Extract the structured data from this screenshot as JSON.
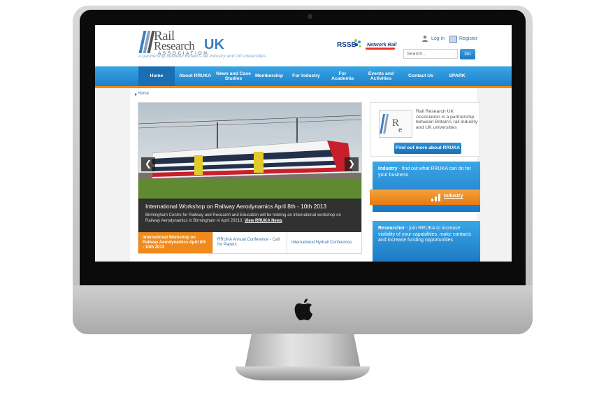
{
  "header": {
    "logo": {
      "rail": "Rail",
      "research": "Research",
      "uk": "UK",
      "association": "ASSOCIATION"
    },
    "tagline": "A partnership between Britain's rail industry and UK universities",
    "partners": {
      "rssb": "RSSB",
      "network_rail": "Network Rail"
    },
    "login_label": "Log in",
    "register_label": "Register",
    "search_placeholder": "Search...",
    "search_button": "Go"
  },
  "nav": {
    "items": [
      {
        "label": "Home",
        "active": true
      },
      {
        "label": "About RRUKA"
      },
      {
        "label": "News and Case Studies"
      },
      {
        "label": "Membership"
      },
      {
        "label": "For Industry"
      },
      {
        "label": "For Academia"
      },
      {
        "label": "Events and Activities"
      },
      {
        "label": "Contact Us"
      },
      {
        "label": "SPARK"
      }
    ]
  },
  "breadcrumb": {
    "home": "Home"
  },
  "slider": {
    "title": "International Workshop on Railway Aerodynamics April 8th - 10th 2013",
    "text": "Birmingham Centre for Railway and Research and Education will be  holding an international workshop on Railway Aerodynamics in Birmingham in April 20213.",
    "link": "View RRUKA News",
    "prev": "❮",
    "next": "❯",
    "tabs": [
      {
        "label": "International Workshop on Railway Aerodynamics April 8th - 10th 2013",
        "active": true
      },
      {
        "label": "RRUKA Annual Conference - Call for Papers"
      },
      {
        "label": "International Hydrail Conference"
      }
    ]
  },
  "sidebar": {
    "about_text": "Rail Research UK Association is a partnership between Britain's rail industry and UK universities",
    "about_button": "Find out more about RRUKA",
    "industry": {
      "title": "Industry",
      "text": " - find out what RRUKA can do for your business",
      "link": "Industry"
    },
    "researcher": {
      "title": "Researcher",
      "text": " - join RRUKA to increase visibility of your capabilities, make contacts and increase funding opportunities"
    }
  },
  "colors": {
    "brand_blue": "#1e7fcb",
    "accent_orange": "#f08a1c"
  }
}
